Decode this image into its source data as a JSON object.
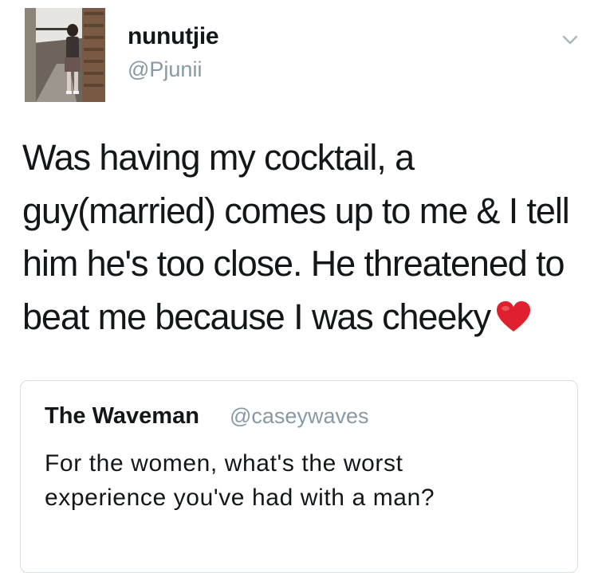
{
  "author": {
    "display_name": "nunutjie",
    "handle": "@Pjunii",
    "avatar_icon": "profile-photo"
  },
  "tweet": {
    "lines": [
      "Was having my cocktail, a",
      "guy(married) comes up to me & I tell",
      "him he's too close. He threatened to",
      "beat me because I was cheeky"
    ],
    "emoji": "red-heart-icon"
  },
  "quoted_tweet": {
    "display_name": "The Waveman",
    "handle": "@caseywaves",
    "lines": [
      "For the women, what's the worst",
      "experience you've had with a man?"
    ]
  },
  "colors": {
    "text_primary": "#14171a",
    "text_secondary": "#8899a6",
    "border": "#d8dde1",
    "heart": "#e0202e"
  },
  "icons": {
    "menu": "chevron-down-icon"
  }
}
